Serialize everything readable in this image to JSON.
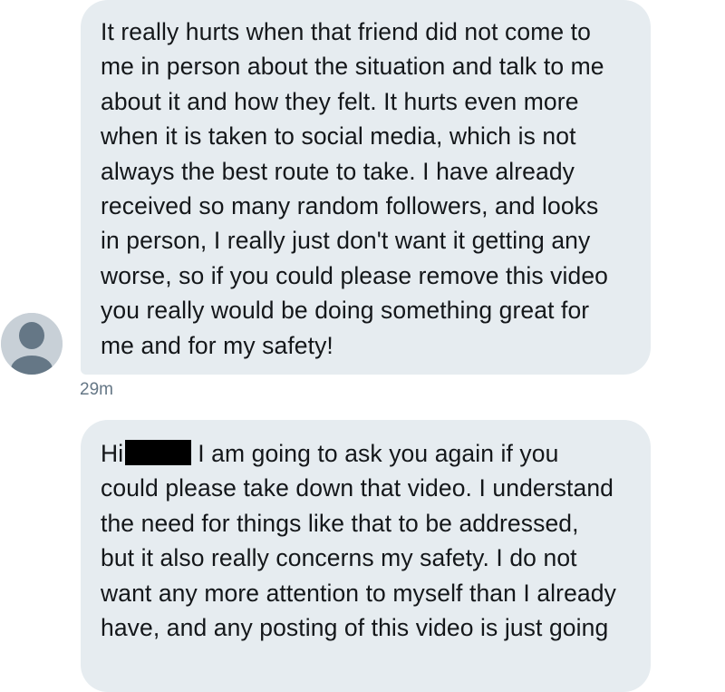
{
  "messages": [
    {
      "lines": [
        "It really hurts when that friend did not come to",
        "me in person about the situation and talk to me",
        "about it and how they felt. It hurts even more",
        "when it is taken to social media, which is not",
        "always the best route to take. I have already",
        "received so many random followers, and looks",
        "in person, I really just don't want it getting any",
        "worse, so if you could please remove this video",
        "you really would be doing something great for",
        "me and for my safety!"
      ],
      "timestamp": "29m"
    },
    {
      "greeting": "Hi",
      "first_line_rest": "I am going to ask you again if you",
      "lines": [
        "could please take down that video. I understand",
        "the need for things like that to be addressed,",
        "but it also really concerns my safety. I do not",
        "want any more attention to myself than I already",
        "have, and any posting of this video is just going"
      ]
    }
  ],
  "avatar": {
    "icon": "default-profile-avatar-icon",
    "color": "#c8d0d7"
  }
}
